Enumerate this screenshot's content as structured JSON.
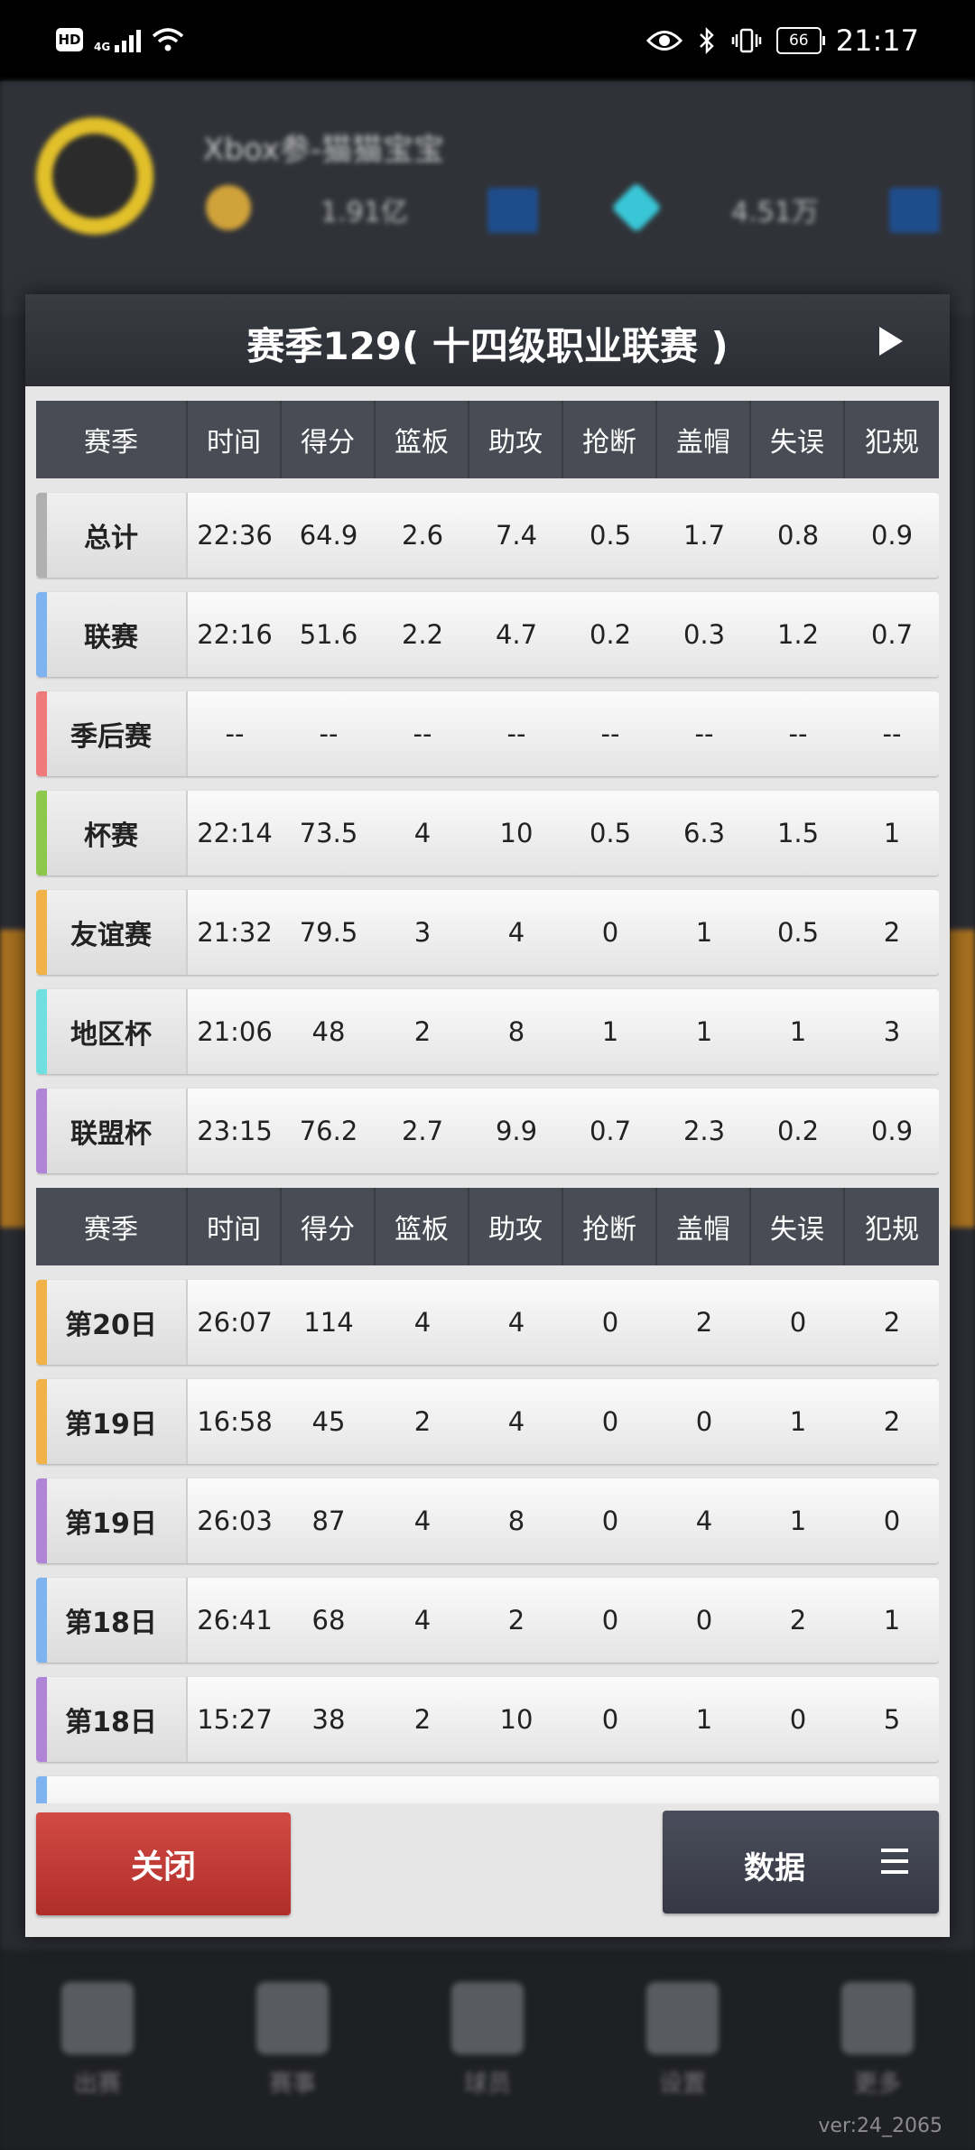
{
  "status_bar": {
    "network": "4G",
    "battery": "66",
    "time": "21:17"
  },
  "background": {
    "team_name": "Xbox参-猫猫宝宝",
    "coins": "1.91亿",
    "gems": "4.51万",
    "nav": [
      "出赛",
      "赛事",
      "球员",
      "设置",
      "更多"
    ],
    "version": "ver:24_2065"
  },
  "dialog": {
    "title": "赛季129( 十四级职业联赛 )",
    "headers": [
      "赛季",
      "时间",
      "得分",
      "篮板",
      "助攻",
      "抢断",
      "盖帽",
      "失误",
      "犯规"
    ],
    "season_rows": [
      {
        "label": "总计",
        "color": "#b0b0b0",
        "values": [
          "22:36",
          "64.9",
          "2.6",
          "7.4",
          "0.5",
          "1.7",
          "0.8",
          "0.9"
        ]
      },
      {
        "label": "联赛",
        "color": "#7fb3f0",
        "values": [
          "22:16",
          "51.6",
          "2.2",
          "4.7",
          "0.2",
          "0.3",
          "1.2",
          "0.7"
        ]
      },
      {
        "label": "季后赛",
        "color": "#ef7a7a",
        "values": [
          "--",
          "--",
          "--",
          "--",
          "--",
          "--",
          "--",
          "--"
        ]
      },
      {
        "label": "杯赛",
        "color": "#8cc84b",
        "values": [
          "22:14",
          "73.5",
          "4",
          "10",
          "0.5",
          "6.3",
          "1.5",
          "1"
        ]
      },
      {
        "label": "友谊赛",
        "color": "#f2b24a",
        "values": [
          "21:32",
          "79.5",
          "3",
          "4",
          "0",
          "1",
          "0.5",
          "2"
        ]
      },
      {
        "label": "地区杯",
        "color": "#6fe0df",
        "values": [
          "21:06",
          "48",
          "2",
          "8",
          "1",
          "1",
          "1",
          "3"
        ]
      },
      {
        "label": "联盟杯",
        "color": "#b084d6",
        "values": [
          "23:15",
          "76.2",
          "2.7",
          "9.9",
          "0.7",
          "2.3",
          "0.2",
          "0.9"
        ]
      }
    ],
    "game_rows": [
      {
        "label": "第20日",
        "color": "#f2b24a",
        "values": [
          "26:07",
          "114",
          "4",
          "4",
          "0",
          "2",
          "0",
          "2"
        ]
      },
      {
        "label": "第19日",
        "color": "#f2b24a",
        "values": [
          "16:58",
          "45",
          "2",
          "4",
          "0",
          "0",
          "1",
          "2"
        ]
      },
      {
        "label": "第19日",
        "color": "#b084d6",
        "values": [
          "26:03",
          "87",
          "4",
          "8",
          "0",
          "4",
          "1",
          "0"
        ]
      },
      {
        "label": "第18日",
        "color": "#7fb3f0",
        "values": [
          "26:41",
          "68",
          "4",
          "2",
          "0",
          "0",
          "2",
          "1"
        ]
      },
      {
        "label": "第18日",
        "color": "#b084d6",
        "values": [
          "15:27",
          "38",
          "2",
          "10",
          "0",
          "1",
          "0",
          "5"
        ]
      }
    ],
    "close_label": "关闭",
    "data_label": "数据"
  }
}
